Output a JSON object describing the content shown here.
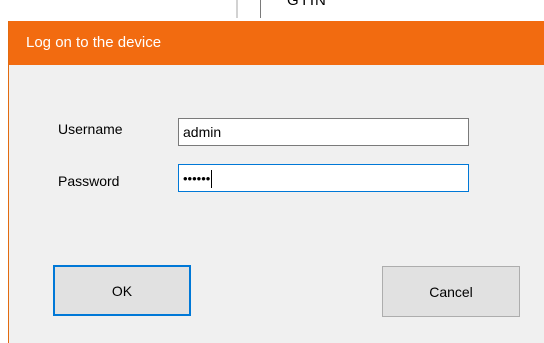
{
  "background": {
    "column_header": "GTIN"
  },
  "dialog": {
    "title": "Log on to the device",
    "title_bar_color": "#f26b10",
    "username_label": "Username",
    "username_value": "admin",
    "password_label": "Password",
    "password_masked": "••••••",
    "ok_label": "OK",
    "cancel_label": "Cancel"
  }
}
